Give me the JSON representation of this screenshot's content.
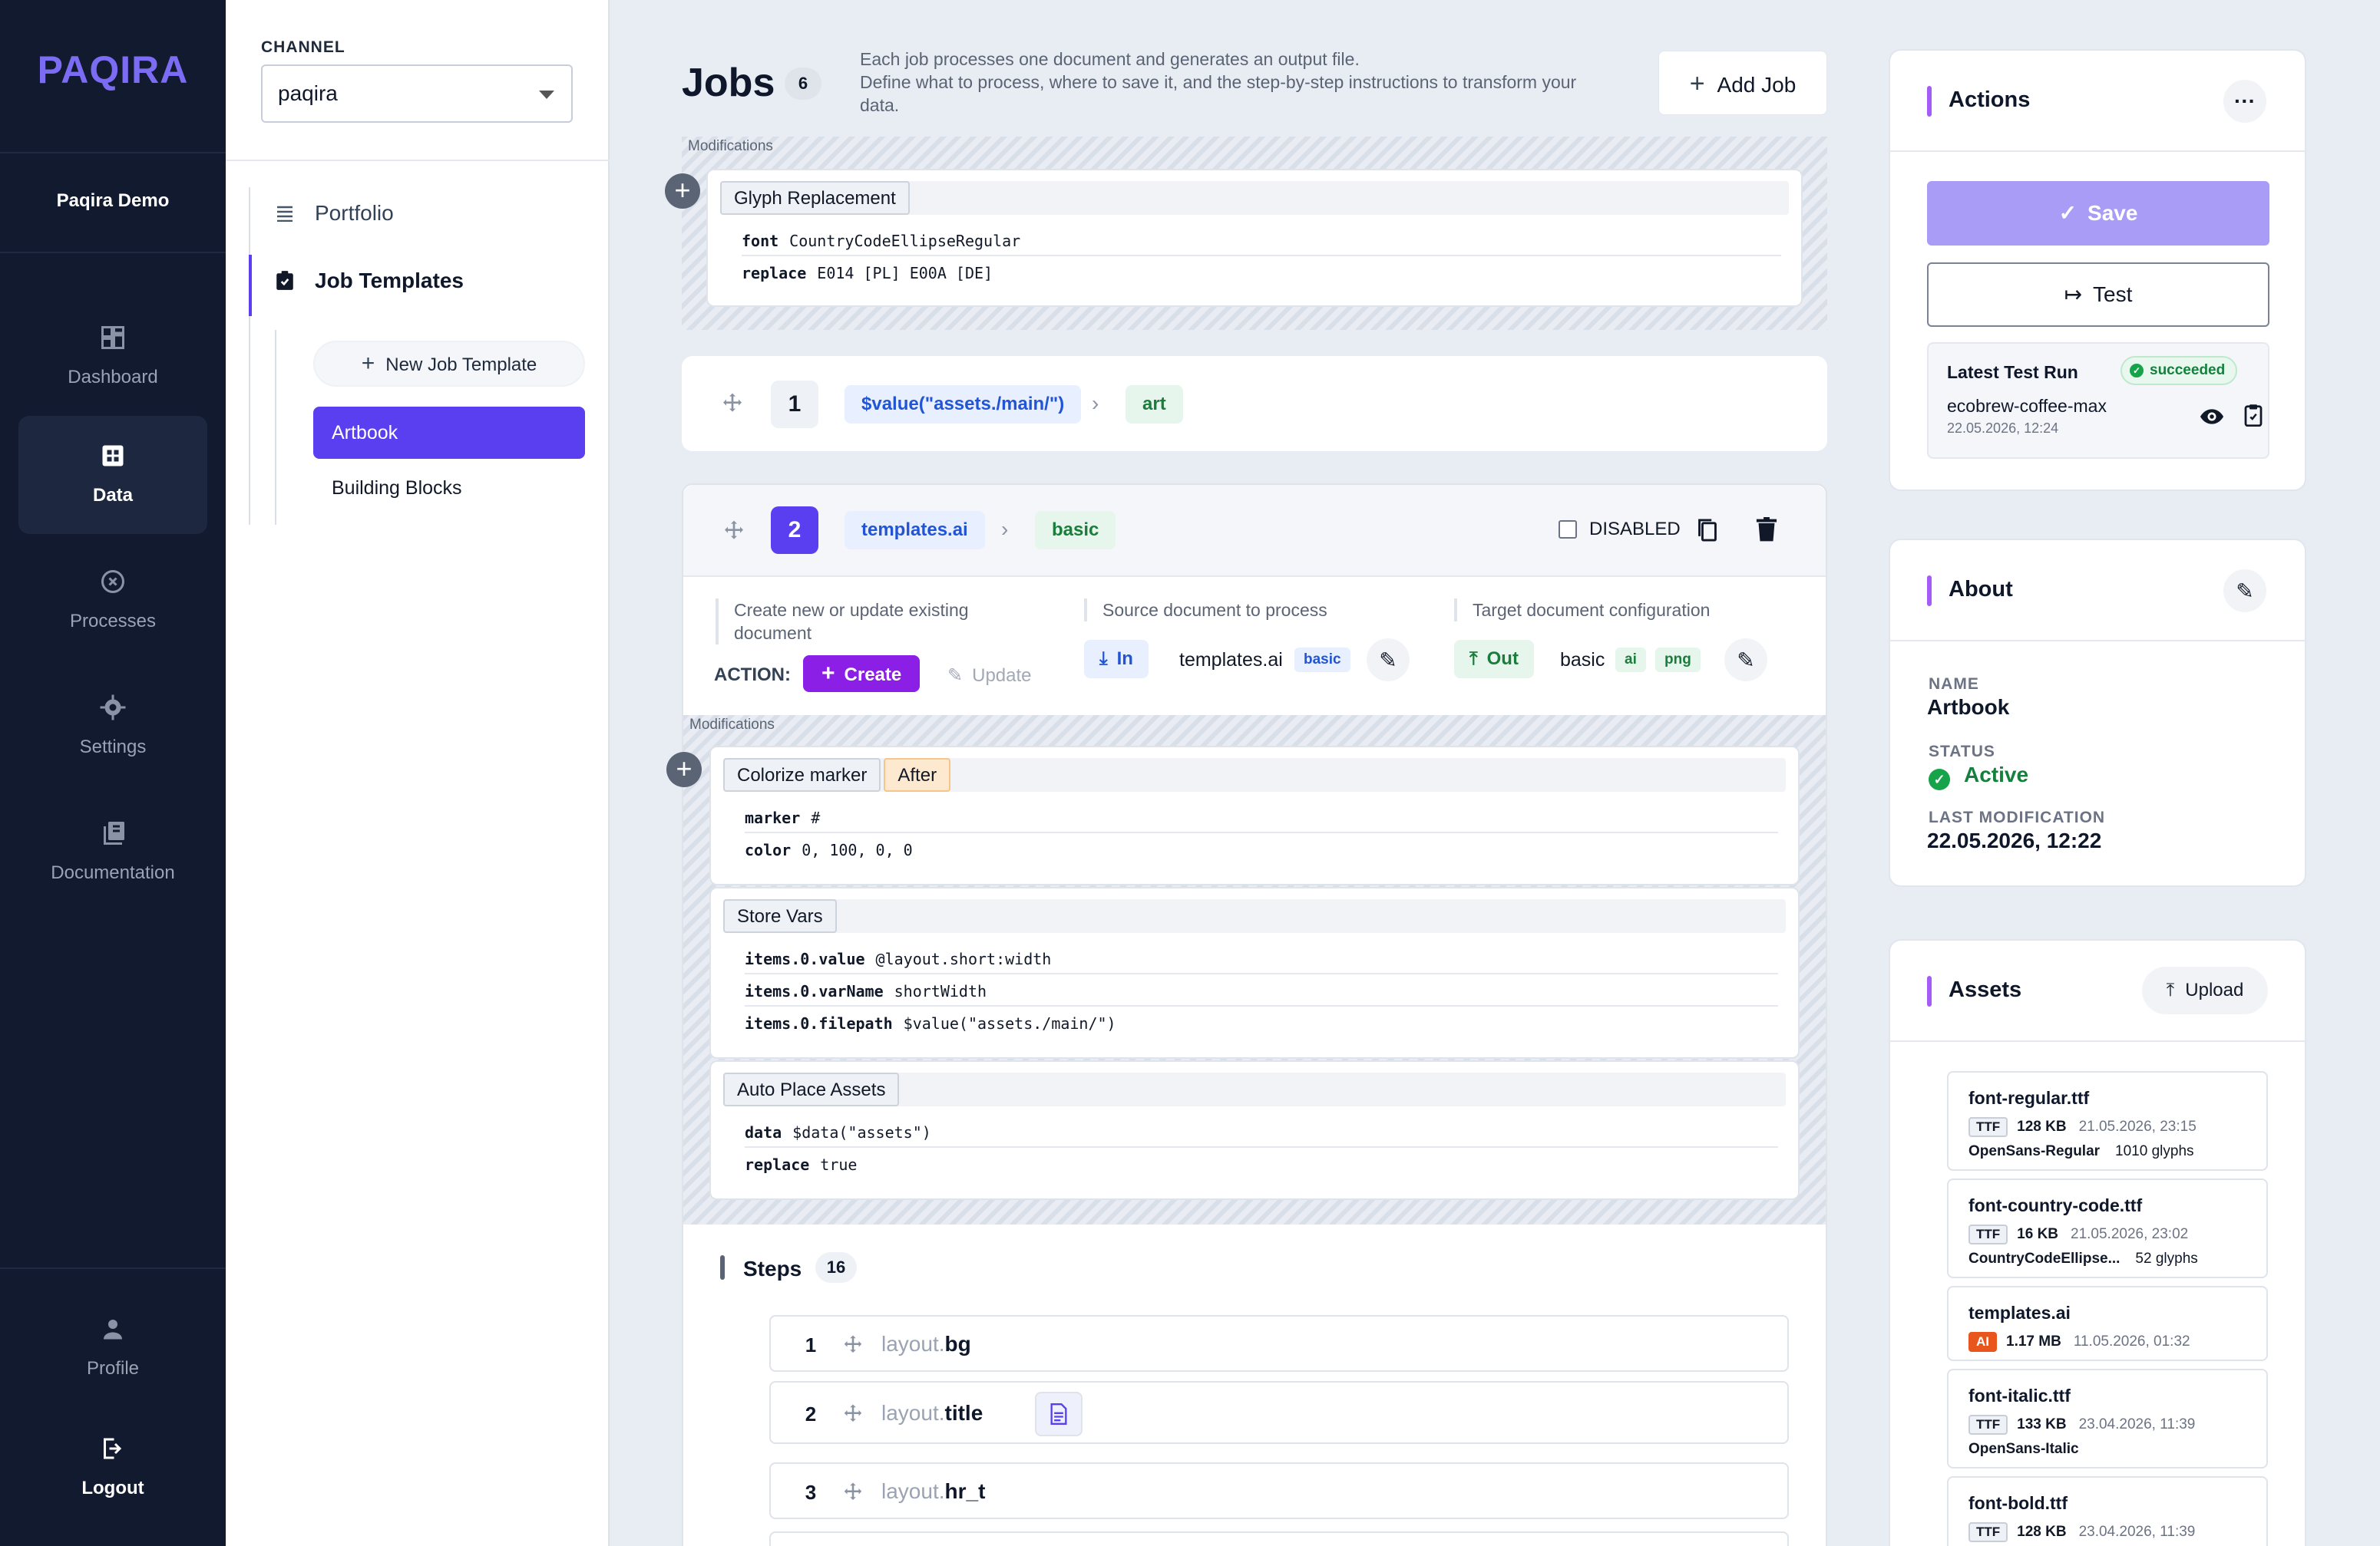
{
  "app": {
    "logo": "PAQIRA",
    "org": "Paqira Demo"
  },
  "nav": {
    "items": [
      {
        "label": "Dashboard",
        "icon": "dashboard-icon"
      },
      {
        "label": "Data",
        "icon": "data-icon"
      },
      {
        "label": "Processes",
        "icon": "processes-icon"
      },
      {
        "label": "Settings",
        "icon": "settings-icon"
      },
      {
        "label": "Documentation",
        "icon": "documentation-icon"
      }
    ],
    "profile": "Profile",
    "logout": "Logout"
  },
  "sidebar": {
    "channel_label": "CHANNEL",
    "channel_value": "paqira",
    "links": [
      "Portfolio",
      "Job Templates"
    ],
    "new_template": "New Job Template",
    "templates": [
      "Artbook",
      "Building Blocks"
    ]
  },
  "jobs": {
    "title": "Jobs",
    "count": "6",
    "desc1": "Each job processes one document and generates an output file.",
    "desc2": "Define what to process, where to save it, and the step-by-step instructions to transform your data.",
    "add_job": "Add Job",
    "modifications_label": "Modifications",
    "top_mod": {
      "name": "Glyph Replacement",
      "rows": [
        {
          "k": "font",
          "v": "CountryCodeEllipseRegular"
        },
        {
          "k": "replace",
          "v": "E014 [PL] E00A [DE]"
        }
      ]
    },
    "job1": {
      "num": "1",
      "source": "$value(\"assets./main/\")",
      "target": "art"
    },
    "job2": {
      "num": "2",
      "source": "templates.ai",
      "target": "basic",
      "disabled_label": "DISABLED",
      "action_desc": "Create new or update existing document",
      "action_label": "ACTION:",
      "create": "Create",
      "update": "Update",
      "source_desc": "Source document to process",
      "in_label": "In",
      "in_file": "templates.ai",
      "in_tag": "basic",
      "target_desc": "Target document configuration",
      "out_label": "Out",
      "out_name": "basic",
      "out_tags": [
        "ai",
        "png"
      ],
      "mods": [
        {
          "name": "Colorize marker",
          "tag": "After",
          "rows": [
            {
              "k": "marker",
              "v": "#"
            },
            {
              "k": "color",
              "v": "0, 100, 0, 0"
            }
          ]
        },
        {
          "name": "Store Vars",
          "rows": [
            {
              "k": "items.0.value",
              "v": "@layout.short:width"
            },
            {
              "k": "items.0.varName",
              "v": "shortWidth"
            },
            {
              "k": "items.0.filepath",
              "v": "$value(\"assets./main/\")"
            }
          ]
        },
        {
          "name": "Auto Place Assets",
          "rows": [
            {
              "k": "data",
              "v": "$data(\"assets\")"
            },
            {
              "k": "replace",
              "v": "true"
            }
          ]
        }
      ],
      "steps_label": "Steps",
      "steps_count": "16",
      "steps": [
        {
          "n": "1",
          "pre": "layout.",
          "main": "bg"
        },
        {
          "n": "2",
          "pre": "layout.",
          "main": "title"
        },
        {
          "n": "3",
          "pre": "layout.",
          "main": "hr_t"
        }
      ]
    }
  },
  "actions": {
    "title": "Actions",
    "save": "Save",
    "test": "Test",
    "latest_label": "Latest Test Run",
    "status": "succeeded",
    "run_name": "ecobrew-coffee-max",
    "run_time": "22.05.2026, 12:24"
  },
  "about": {
    "title": "About",
    "name_label": "NAME",
    "name": "Artbook",
    "status_label": "STATUS",
    "status": "Active",
    "mod_label": "LAST MODIFICATION",
    "mod": "22.05.2026, 12:22"
  },
  "assets": {
    "title": "Assets",
    "upload": "Upload",
    "items": [
      {
        "name": "font-regular.ttf",
        "type": "TTF",
        "size": "128 KB",
        "date": "21.05.2026, 23:15",
        "family": "OpenSans-Regular",
        "glyphs": "1010 glyphs"
      },
      {
        "name": "font-country-code.ttf",
        "type": "TTF",
        "size": "16 KB",
        "date": "21.05.2026, 23:02",
        "family": "CountryCodeEllipse...",
        "glyphs": "52 glyphs"
      },
      {
        "name": "templates.ai",
        "type": "AI",
        "size": "1.17 MB",
        "date": "11.05.2026, 01:32"
      },
      {
        "name": "font-italic.ttf",
        "type": "TTF",
        "size": "133 KB",
        "date": "23.04.2026, 11:39",
        "family": "OpenSans-Italic"
      },
      {
        "name": "font-bold.ttf",
        "type": "TTF",
        "size": "128 KB",
        "date": "23.04.2026, 11:39"
      }
    ]
  },
  "colors": {
    "accent": "#5a3ff0",
    "nav_bg": "#111a2e",
    "save_bg": "#a99cf7",
    "success": "#16a34a"
  }
}
